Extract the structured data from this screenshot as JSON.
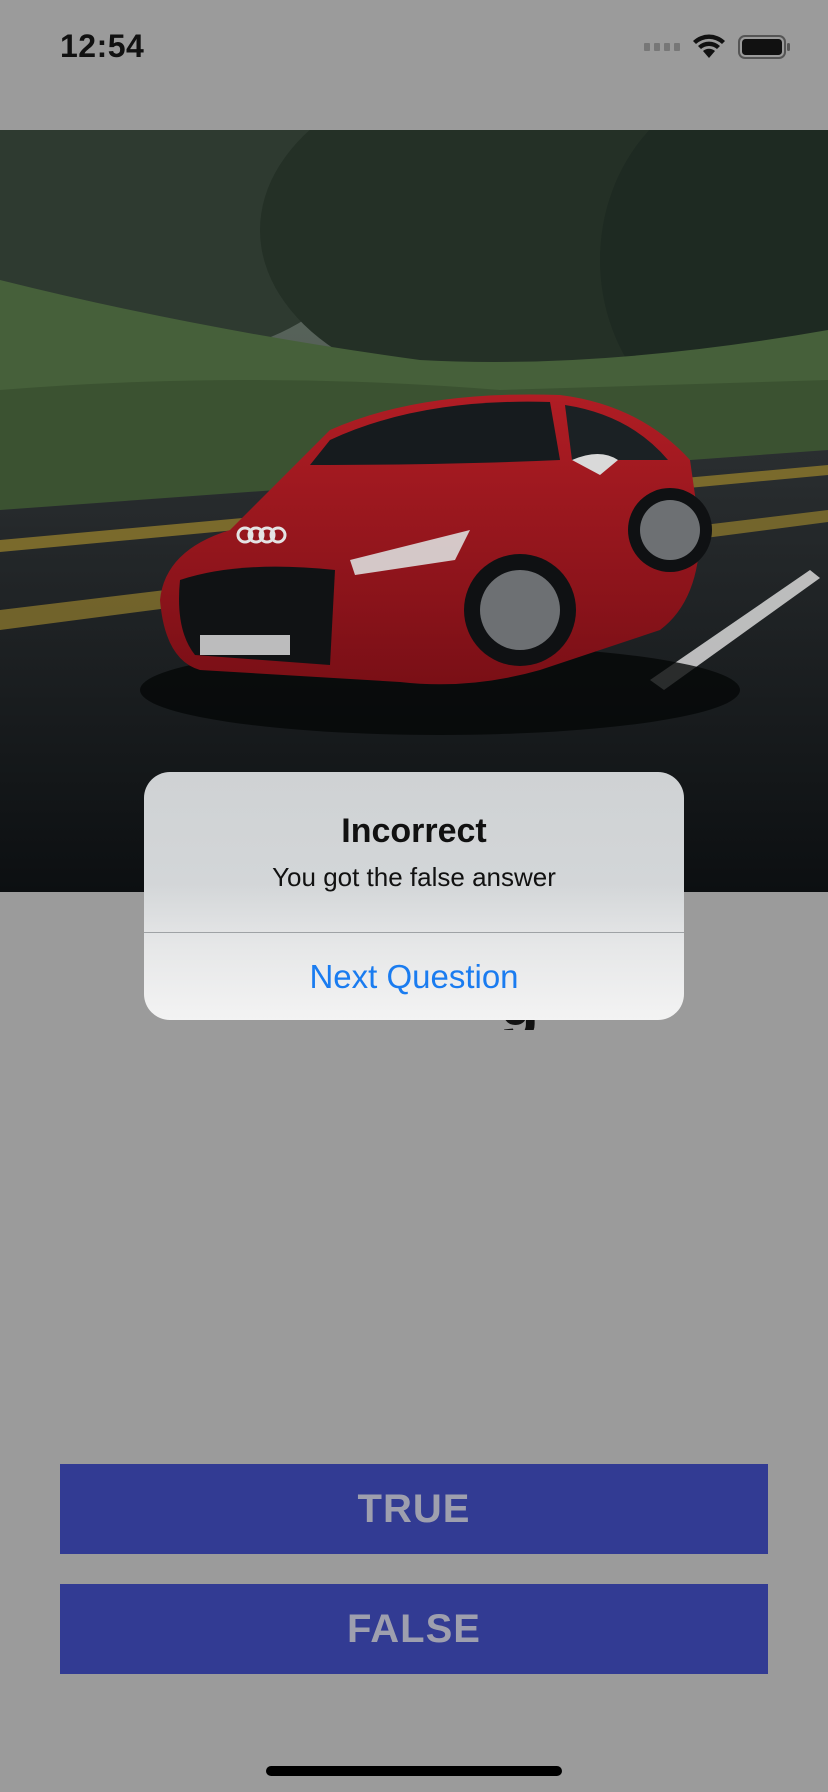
{
  "status_bar": {
    "time": "12:54"
  },
  "photo": {
    "car_badge": "Audi Sport"
  },
  "question": {
    "visible_fragment": "g"
  },
  "answers": {
    "true_label": "TRUE",
    "false_label": "FALSE"
  },
  "alert": {
    "title": "Incorrect",
    "message": "You got the false answer",
    "action_label": "Next Question"
  },
  "colors": {
    "button_bg": "#323b93",
    "button_text": "#9e9fae",
    "alert_action": "#1a7cf0",
    "dim_background": "#9b9b9b"
  }
}
